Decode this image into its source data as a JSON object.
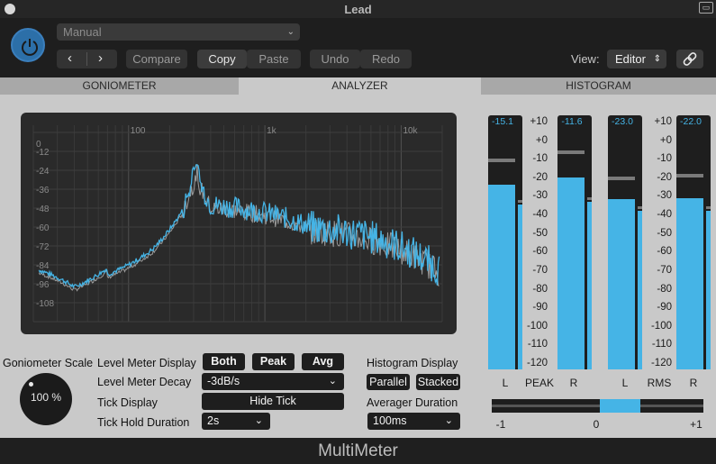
{
  "window": {
    "title": "Lead"
  },
  "header": {
    "preset": "Manual",
    "compare": "Compare",
    "copy": "Copy",
    "paste": "Paste",
    "undo": "Undo",
    "redo": "Redo",
    "view_label": "View:",
    "view_value": "Editor",
    "nav_back": "‹",
    "nav_forward": "›"
  },
  "tabs": [
    "GONIOMETER",
    "ANALYZER",
    "HISTOGRAM"
  ],
  "active_tab": "ANALYZER",
  "spectrum": {
    "freq_labels": [
      "100",
      "1k",
      "10k"
    ],
    "db_labels": [
      "0",
      "-12",
      "-24",
      "-36",
      "-48",
      "-60",
      "-72",
      "-84",
      "-96",
      "-108"
    ],
    "colors": {
      "live": "#45b4e6",
      "hold": "#9a9a9a"
    }
  },
  "controls": {
    "goniometer_scale_label": "Goniometer Scale",
    "goniometer_scale_value": "100 %",
    "level_meter_display_label": "Level Meter Display",
    "level_meter_display_options": [
      "Both",
      "Peak",
      "Avg"
    ],
    "level_meter_decay_label": "Level Meter Decay",
    "level_meter_decay_value": "-3dB/s",
    "tick_display_label": "Tick Display",
    "tick_display_value": "Hide Tick",
    "tick_hold_duration_label": "Tick Hold Duration",
    "tick_hold_duration_value": "2s",
    "histogram_display_label": "Histogram Display",
    "histogram_display_options": [
      "Parallel",
      "Stacked"
    ],
    "averager_duration_label": "Averager Duration",
    "averager_duration_value": "100ms"
  },
  "meters": {
    "peak": {
      "L_readout": "-15.1",
      "R_readout": "-11.6",
      "L_level": 0.728,
      "R_level": 0.755,
      "L_tick": 0.83,
      "R_tick": 0.86,
      "L_side": 0.65,
      "R_side": 0.66
    },
    "rms": {
      "L_readout": "-23.0",
      "R_readout": "-22.0",
      "L_level": 0.67,
      "R_level": 0.675,
      "L_tick": 0.76,
      "R_tick": 0.77,
      "L_side": 0.625,
      "R_side": 0.625
    },
    "scale": [
      "+10",
      "+0",
      "-10",
      "-20",
      "-30",
      "-40",
      "-50",
      "-60",
      "-70",
      "-80",
      "-90",
      "-100",
      "-110",
      "-120"
    ],
    "labels": {
      "peak_l": "L",
      "peak": "PEAK",
      "peak_r": "R",
      "rms_l": "L",
      "rms": "RMS",
      "rms_r": "R"
    },
    "correlation": {
      "min": "-1",
      "mid": "0",
      "max": "+1"
    }
  },
  "footer": {
    "title": "MultiMeter"
  }
}
